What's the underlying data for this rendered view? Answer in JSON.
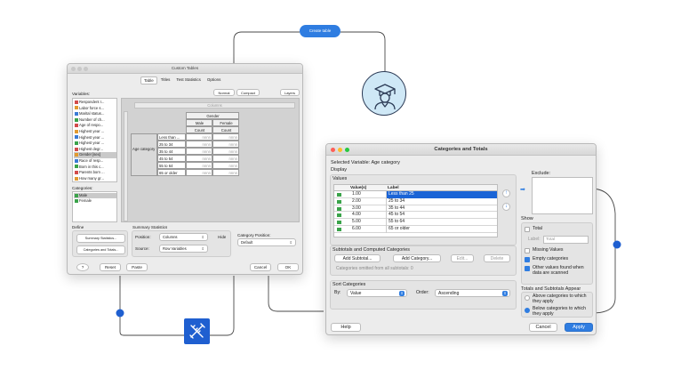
{
  "create_table": {
    "label": "Create table"
  },
  "custom_tables": {
    "title": "Custom Tables",
    "tabs": [
      "Table",
      "Titles",
      "Test Statistics",
      "Options"
    ],
    "view_buttons": {
      "normal": "Normal",
      "compact": "Compact",
      "layers": "Layers"
    },
    "variables_label": "Variables:",
    "variables": [
      "Respondent I...",
      "Labor force s...",
      "Marital status...",
      "Number of ch...",
      "Age of respo...",
      "Highest year ...",
      "Highest year ...",
      "Highest year ...",
      "Highest degr...",
      "Gender [sex]",
      "Race of resp...",
      "Born in this c...",
      "Parents born ...",
      "How many gr..."
    ],
    "selected_variable_index": 9,
    "categories_label": "Categories:",
    "categories": [
      "Male",
      "Female"
    ],
    "columns_label": "Columns",
    "preview": {
      "col_header": "Gender",
      "col_cats": [
        "Male",
        "Female"
      ],
      "stat": "Count",
      "row_header": "Age category",
      "row_cats": [
        "Less than ...",
        "25 to 34",
        "35 to 44",
        "45 to 54",
        "55 to 64",
        "65 or older"
      ],
      "cell": "nnnn"
    },
    "define_label": "Define",
    "summary_statistics_button": "Summary Statistics...",
    "categories_totals_button": "Categories and Totals...",
    "summary_stats_group": "Summary Statistics",
    "position_label": "Position:",
    "position_value": "Columns",
    "source_label": "Source:",
    "source_value": "Row Variables",
    "hide_label": "Hide",
    "category_position_label": "Category Position:",
    "category_position_value": "Default",
    "footer": {
      "help": "?",
      "reset": "Reset",
      "paste": "Paste",
      "cancel": "Cancel",
      "ok": "OK"
    }
  },
  "categories_totals": {
    "title": "Categories and Totals",
    "selected_variable": "Selected Variable: Age category",
    "display_label": "Display",
    "values_label": "Values",
    "col_value": "Value(s)",
    "col_label": "Label",
    "rows": [
      {
        "value": "1.00",
        "label": "Less than 25",
        "selected": true
      },
      {
        "value": "2.00",
        "label": "25 to 34",
        "selected": false
      },
      {
        "value": "3.00",
        "label": "35 to 44",
        "selected": false
      },
      {
        "value": "4.00",
        "label": "45 to 54",
        "selected": false
      },
      {
        "value": "5.00",
        "label": "55 to 64",
        "selected": false
      },
      {
        "value": "6.00",
        "label": "65 or older",
        "selected": false
      }
    ],
    "exclude_label": "Exclude:",
    "show_label": "Show",
    "total_label": "Total",
    "label_label": "Label:",
    "label_placeholder": "Total",
    "missing_values": "Missing Values",
    "empty_categories": "Empty categories",
    "other_values": "Other values found when data are scanned",
    "subtotals_group": "Subtotals and Computed Categories",
    "add_subtotal": "Add Subtotal...",
    "add_category": "Add Category...",
    "edit": "Edit...",
    "delete": "Delete",
    "omitted_note": "Categories omitted from all subtotals: 0",
    "sort_group": "Sort Categories",
    "by_label": "By:",
    "by_value": "Value",
    "order_label": "Order:",
    "order_value": "Ascending",
    "totals_appear_group": "Totals and Subtotals Appear",
    "above": "Above categories to which they apply",
    "below": "Below categories to which they apply",
    "footer": {
      "help": "Help",
      "cancel": "Cancel",
      "apply": "Apply"
    }
  },
  "colors": {
    "accent": "#2f7de1",
    "node_fill": "#cfe8f6",
    "tools": "#1f5fd0"
  },
  "icons": [
    "user-graduate-icon",
    "pencil-ruler-icon"
  ]
}
